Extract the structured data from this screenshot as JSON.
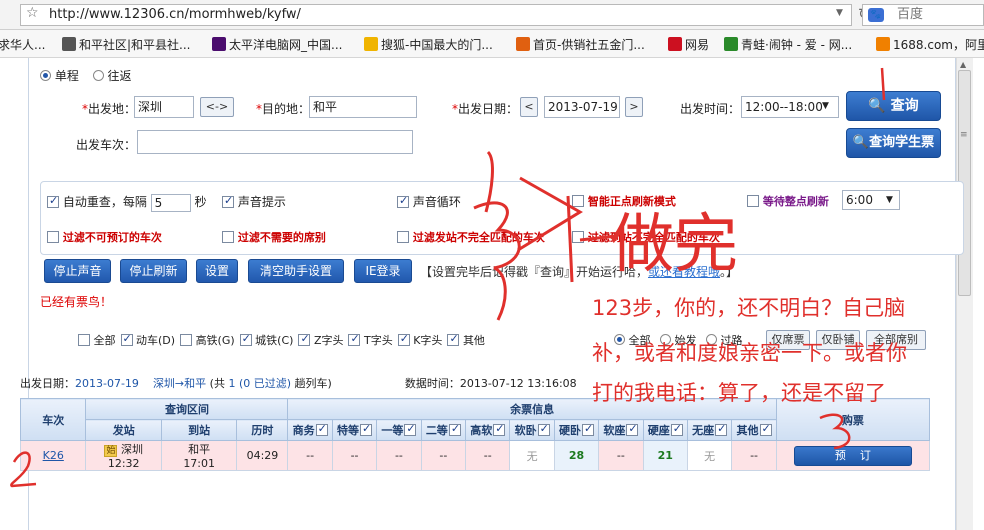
{
  "browser": {
    "url": "http://www.12306.cn/mormhweb/kyfw/",
    "search_placeholder": "百度",
    "bookmarks": [
      {
        "label": "求华人...",
        "color": "#c64"
      },
      {
        "label": "和平社区|和平县社...",
        "color": "#333"
      },
      {
        "label": "太平洋电脑网_中国...",
        "color": "#4b0d6e"
      },
      {
        "label": "搜狐-中国最大的门...",
        "color": "#f0b400"
      },
      {
        "label": "首页-供销社五金门...",
        "color": "#e06010"
      },
      {
        "label": "网易",
        "color": "#cc1020"
      },
      {
        "label": "青蛙·闹钟 - 爱 - 网...",
        "color": "#2a8a2a"
      },
      {
        "label": "1688.com，阿里",
        "color": "#f08000"
      }
    ]
  },
  "form": {
    "trip_single": "单程",
    "trip_round": "往返",
    "from_label": "出发地：",
    "from_value": "深圳",
    "swap_label": "<->",
    "to_label": "目的地：",
    "to_value": "和平",
    "date_label": "出发日期：",
    "date_prev": "<",
    "date_value": "2013-07-19",
    "date_next": ">",
    "time_label": "出发时间：",
    "time_value": "12:00--18:00",
    "train_label": "出发车次：",
    "train_value": "",
    "query_btn": "查询",
    "student_btn": "查询学生票"
  },
  "options": {
    "auto_repeat_pre": "自动重查，每隔",
    "auto_repeat_value": "5",
    "auto_repeat_post": "秒",
    "sound_tip": "声音提示",
    "sound_loop": "声音循环",
    "smart_mode": "智能正点刷新模式",
    "wait_refresh": "等待整点刷新",
    "wait_time": "6:00",
    "filter_unbookable": "过滤不可预订的车次",
    "filter_seats": "过滤不需要的席别",
    "filter_from_station": "过滤发站不完全匹配的车次",
    "filter_to_station": "过滤到站不完全匹配的车次"
  },
  "actions": {
    "stop_sound": "停止声音",
    "stop_refresh": "停止刷新",
    "settings": "设置",
    "clear_settings": "清空助手设置",
    "ie_login": "IE登录",
    "info_prefix": "【设置完毕后记得戳『查询』开始运行哈，",
    "info_link": "或还看教程哦",
    "info_suffix": "。】"
  },
  "have_ticket": "已经有票鸟！",
  "train_filter": {
    "types": [
      "全部",
      "动车(D)",
      "高铁(G)",
      "城铁(C)",
      "Z字头",
      "T字头",
      "K字头",
      "其他"
    ],
    "checked": [
      false,
      true,
      false,
      true,
      true,
      true,
      true,
      true
    ],
    "radio_all": "全部",
    "radio_from": "始发",
    "radio_pass": "过路",
    "btn_hard": "仅席票",
    "btn_sleeper": "仅卧铺",
    "btn_all_seat": "全部席别"
  },
  "summary": {
    "date_label": "出发日期：",
    "date_value": "2013-07-19",
    "route": "深圳→和平",
    "count_pre": "(共",
    "count": "1",
    "filtered": "(0 已过滤)",
    "count_post": "趟列车)",
    "data_time_label": "数据时间：",
    "data_time_value": "2013-07-12 13:16:08"
  },
  "table": {
    "h_train": "车次",
    "h_section": "查询区间",
    "h_tickets": "余票信息",
    "h_book": "购票",
    "h_from": "发站",
    "h_to": "到站",
    "h_duration": "历时",
    "seat_headers": [
      "商务",
      "特等",
      "一等",
      "二等",
      "高软",
      "软卧",
      "硬卧",
      "软座",
      "硬座",
      "无座",
      "其他"
    ],
    "rows": [
      {
        "train": "K26",
        "origin_badge": "始",
        "from": "深圳",
        "depart": "12:32",
        "to": "和平",
        "arrive": "17:01",
        "duration": "04:29",
        "seats": [
          "--",
          "--",
          "--",
          "--",
          "--",
          "无",
          "28",
          "--",
          "21",
          "无",
          "--"
        ],
        "book": "预订"
      }
    ]
  },
  "annotations": {
    "step3_text": "做完",
    "msg1": "123步，你的，还不明白？自己脑",
    "msg2": "补，或者和度娘亲密一下。或者你",
    "msg3": "打的我电话：算了，还是不留了",
    "mark1": "1",
    "mark2": "2",
    "mark3": "3"
  }
}
